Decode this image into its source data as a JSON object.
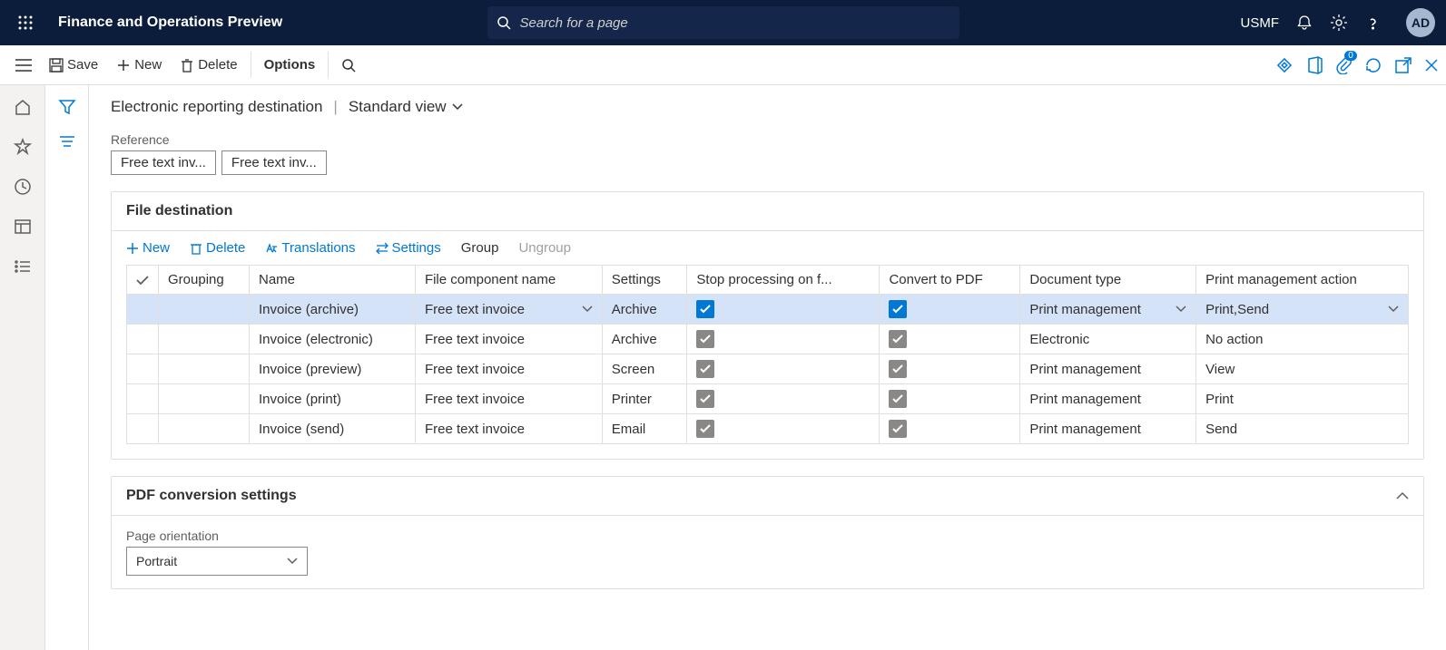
{
  "header": {
    "app_title": "Finance and Operations Preview",
    "search_placeholder": "Search for a page",
    "company": "USMF",
    "avatar_initials": "AD"
  },
  "actionbar": {
    "save": "Save",
    "new": "New",
    "delete": "Delete",
    "options": "Options",
    "attach_badge": "0"
  },
  "breadcrumb": {
    "title": "Electronic reporting destination",
    "view": "Standard view"
  },
  "reference": {
    "label": "Reference",
    "pills": [
      "Free text inv...",
      "Free text inv..."
    ]
  },
  "file_dest": {
    "title": "File destination",
    "toolbar": {
      "new": "New",
      "delete": "Delete",
      "translations": "Translations",
      "settings": "Settings",
      "group": "Group",
      "ungroup": "Ungroup"
    },
    "columns": {
      "grouping": "Grouping",
      "name": "Name",
      "file_component": "File component name",
      "settings": "Settings",
      "stop": "Stop processing on f...",
      "convert": "Convert to PDF",
      "doctype": "Document type",
      "pmaction": "Print management action"
    },
    "rows": [
      {
        "name": "Invoice (archive)",
        "component": "Free text invoice",
        "settings": "Archive",
        "stop": true,
        "convert": true,
        "doctype": "Print management",
        "pmaction": "Print,Send",
        "selected": true
      },
      {
        "name": "Invoice (electronic)",
        "component": "Free text invoice",
        "settings": "Archive",
        "stop": true,
        "convert": true,
        "doctype": "Electronic",
        "pmaction": "No action",
        "selected": false
      },
      {
        "name": "Invoice (preview)",
        "component": "Free text invoice",
        "settings": "Screen",
        "stop": true,
        "convert": true,
        "doctype": "Print management",
        "pmaction": "View",
        "selected": false
      },
      {
        "name": "Invoice (print)",
        "component": "Free text invoice",
        "settings": "Printer",
        "stop": true,
        "convert": true,
        "doctype": "Print management",
        "pmaction": "Print",
        "selected": false
      },
      {
        "name": "Invoice (send)",
        "component": "Free text invoice",
        "settings": "Email",
        "stop": true,
        "convert": true,
        "doctype": "Print management",
        "pmaction": "Send",
        "selected": false
      }
    ]
  },
  "pdf": {
    "title": "PDF conversion settings",
    "orientation_label": "Page orientation",
    "orientation_value": "Portrait"
  }
}
